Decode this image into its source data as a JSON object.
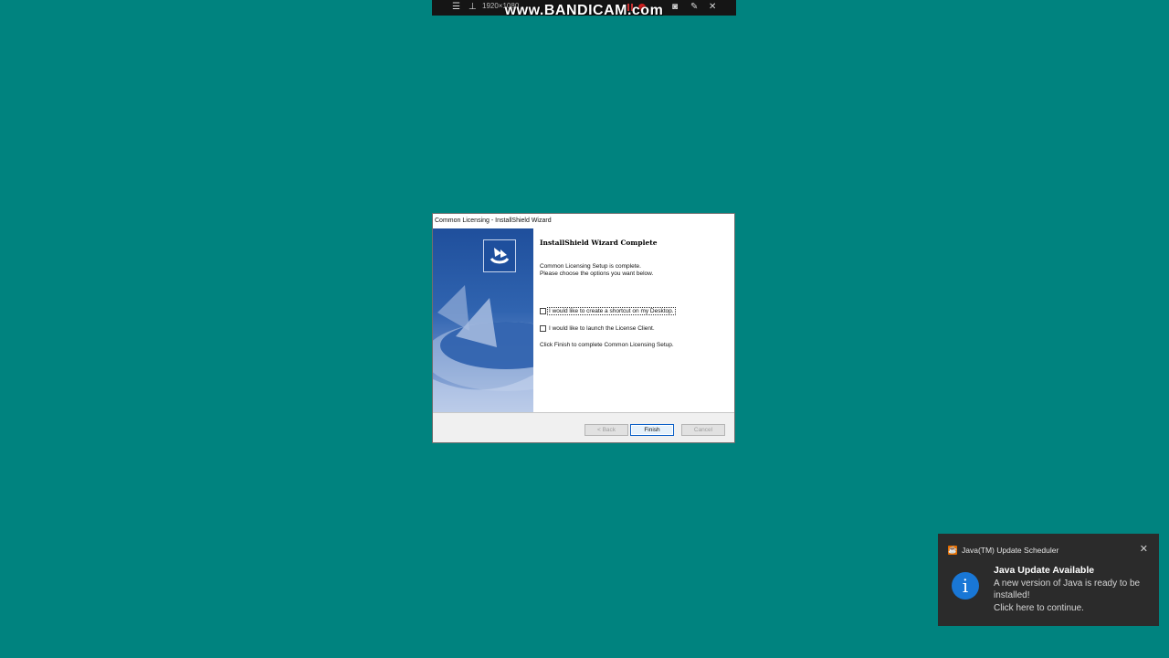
{
  "bandicam": {
    "resolution": "1920×1080",
    "watermark": "www.BANDICAM.com",
    "menu_icon": "hamburger-icon",
    "pin_icon": "pin-icon",
    "camera_icon": "camera-icon",
    "pencil_icon": "pencil-icon",
    "close_icon": "close-icon"
  },
  "dialog": {
    "title": "Common Licensing - InstallShield Wizard",
    "heading": "InstallShield Wizard Complete",
    "line1": "Common Licensing Setup is complete.",
    "line2": "Please choose the options you want below.",
    "checkbox_shortcut": "I would like to create a shortcut on my Desktop.",
    "checkbox_launch": "I would like to launch the License Client.",
    "finish_note": "Click Finish to complete Common Licensing Setup.",
    "buttons": {
      "back": "< Back",
      "finish": "Finish",
      "cancel": "Cancel"
    }
  },
  "toast": {
    "app_name": "Java(TM) Update Scheduler",
    "title": "Java Update Available",
    "body_line1": "A new version of Java is ready to be installed!",
    "body_line2": "Click here to continue.",
    "accent": "#1977d6"
  },
  "colors": {
    "desktop": "#00837f",
    "dialog_side": "#2a5ca8",
    "toast_bg": "#2b2b2b"
  }
}
